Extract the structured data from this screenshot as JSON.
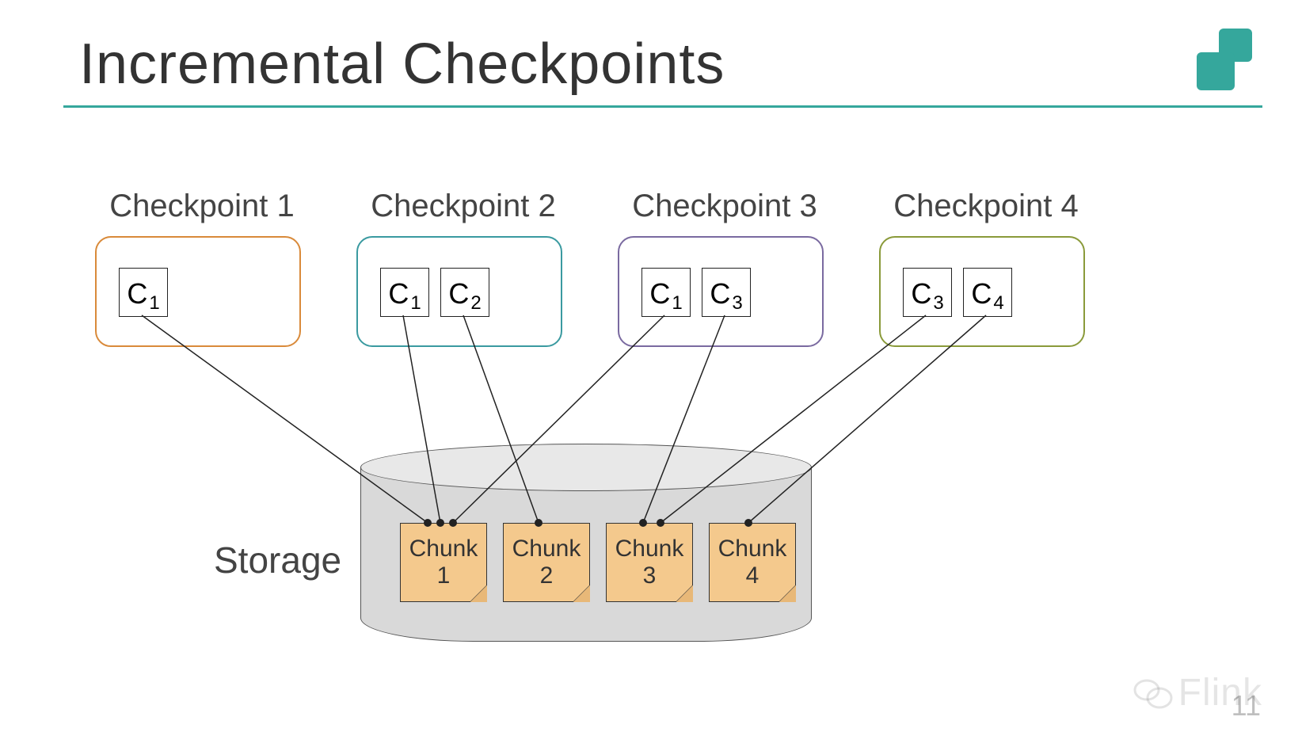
{
  "title": "Incremental Checkpoints",
  "storage_label": "Storage",
  "page_number": "11",
  "watermark": "Flink",
  "checkpoints": [
    {
      "label": "Checkpoint 1",
      "color": "#d98a3a",
      "refs": [
        {
          "c": "C",
          "s": "1"
        }
      ]
    },
    {
      "label": "Checkpoint 2",
      "color": "#3a9aa0",
      "refs": [
        {
          "c": "C",
          "s": "1"
        },
        {
          "c": "C",
          "s": "2"
        }
      ]
    },
    {
      "label": "Checkpoint 3",
      "color": "#7a6aa0",
      "refs": [
        {
          "c": "C",
          "s": "1"
        },
        {
          "c": "C",
          "s": "3"
        }
      ]
    },
    {
      "label": "Checkpoint 4",
      "color": "#8a9a3a",
      "refs": [
        {
          "c": "C",
          "s": "3"
        },
        {
          "c": "C",
          "s": "4"
        }
      ]
    }
  ],
  "chunks": [
    {
      "word": "Chunk",
      "num": "1"
    },
    {
      "word": "Chunk",
      "num": "2"
    },
    {
      "word": "Chunk",
      "num": "3"
    },
    {
      "word": "Chunk",
      "num": "4"
    }
  ]
}
